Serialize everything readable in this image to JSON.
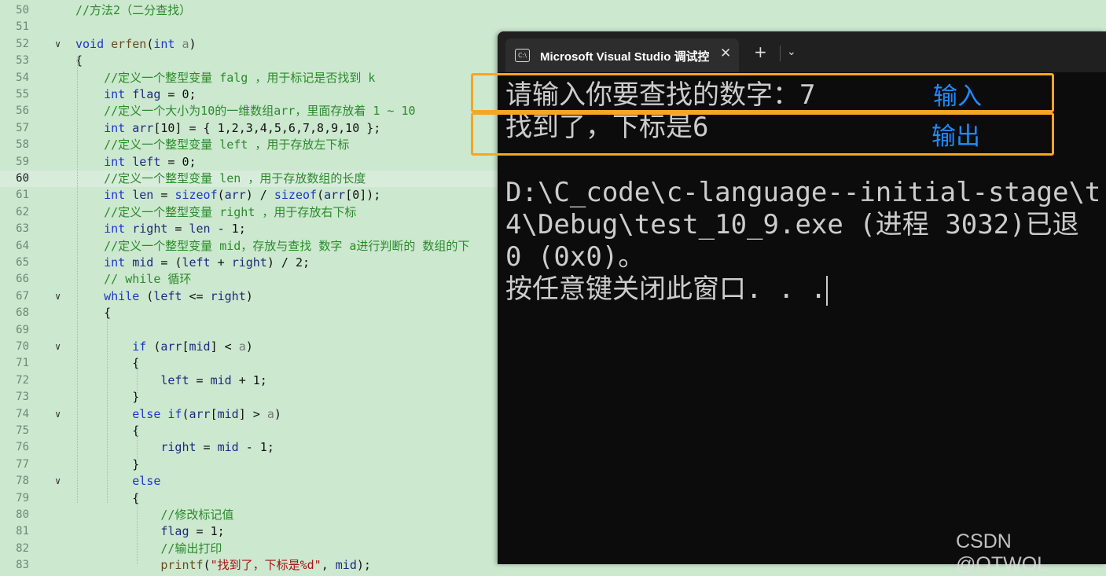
{
  "editor": {
    "current_line": "60",
    "lines": [
      {
        "n": "50",
        "t": "//方法2（二分查找）"
      },
      {
        "n": "51",
        "t": ""
      },
      {
        "n": "52",
        "t": "void erfen(int a)"
      },
      {
        "n": "53",
        "t": "{"
      },
      {
        "n": "54",
        "t": "    //定义一个整型变量 falg ，用于标记是否找到 k"
      },
      {
        "n": "55",
        "t": "    int flag = 0;"
      },
      {
        "n": "56",
        "t": "    //定义一个大小为10的一维数组arr，里面存放着 1 ~ 10"
      },
      {
        "n": "57",
        "t": "    int arr[10] = { 1,2,3,4,5,6,7,8,9,10 };"
      },
      {
        "n": "58",
        "t": "    //定义一个整型变量 left ，用于存放左下标"
      },
      {
        "n": "59",
        "t": "    int left = 0;"
      },
      {
        "n": "60",
        "t": "    //定义一个整型变量 len ，用于存放数组的长度"
      },
      {
        "n": "61",
        "t": "    int len = sizeof(arr) / sizeof(arr[0]);"
      },
      {
        "n": "62",
        "t": "    //定义一个整型变量 right ，用于存放右下标"
      },
      {
        "n": "63",
        "t": "    int right = len - 1;"
      },
      {
        "n": "64",
        "t": "    //定义一个整型变量 mid，存放与查找 数字 a进行判断的 数组的下"
      },
      {
        "n": "65",
        "t": "    int mid = (left + right) / 2;"
      },
      {
        "n": "66",
        "t": "    // while 循环"
      },
      {
        "n": "67",
        "t": "    while (left <= right)"
      },
      {
        "n": "68",
        "t": "    {"
      },
      {
        "n": "69",
        "t": ""
      },
      {
        "n": "70",
        "t": "        if (arr[mid] < a)"
      },
      {
        "n": "71",
        "t": "        {"
      },
      {
        "n": "72",
        "t": "            left = mid + 1;"
      },
      {
        "n": "73",
        "t": "        }"
      },
      {
        "n": "74",
        "t": "        else if(arr[mid] > a)"
      },
      {
        "n": "75",
        "t": "        {"
      },
      {
        "n": "76",
        "t": "            right = mid - 1;"
      },
      {
        "n": "77",
        "t": "        }"
      },
      {
        "n": "78",
        "t": "        else"
      },
      {
        "n": "79",
        "t": "        {"
      },
      {
        "n": "80",
        "t": "            //修改标记值"
      },
      {
        "n": "81",
        "t": "            flag = 1;"
      },
      {
        "n": "82",
        "t": "            //输出打印"
      },
      {
        "n": "83",
        "t": "            printf(\"找到了，下标是%d\", mid);"
      }
    ]
  },
  "terminal": {
    "tab_title": "Microsoft Visual Studio 调试控制台",
    "icon_text": "C:\\",
    "close_glyph": "✕",
    "add_glyph": "+",
    "dropdown_glyph": "⌄",
    "lines": [
      "请输入你要查找的数字：7",
      "找到了，下标是6",
      "",
      "D:\\C_code\\c-language--initial-stage\\t",
      "4\\Debug\\test_10_9.exe (进程 3032)已退",
      "0 (0x0)。",
      "按任意键关闭此窗口. . ."
    ]
  },
  "annotations": {
    "input_label": "输入",
    "output_label": "输出",
    "box_color": "#f5a623",
    "label_color": "#1f8bff"
  },
  "watermark": "CSDN @OTWOL"
}
